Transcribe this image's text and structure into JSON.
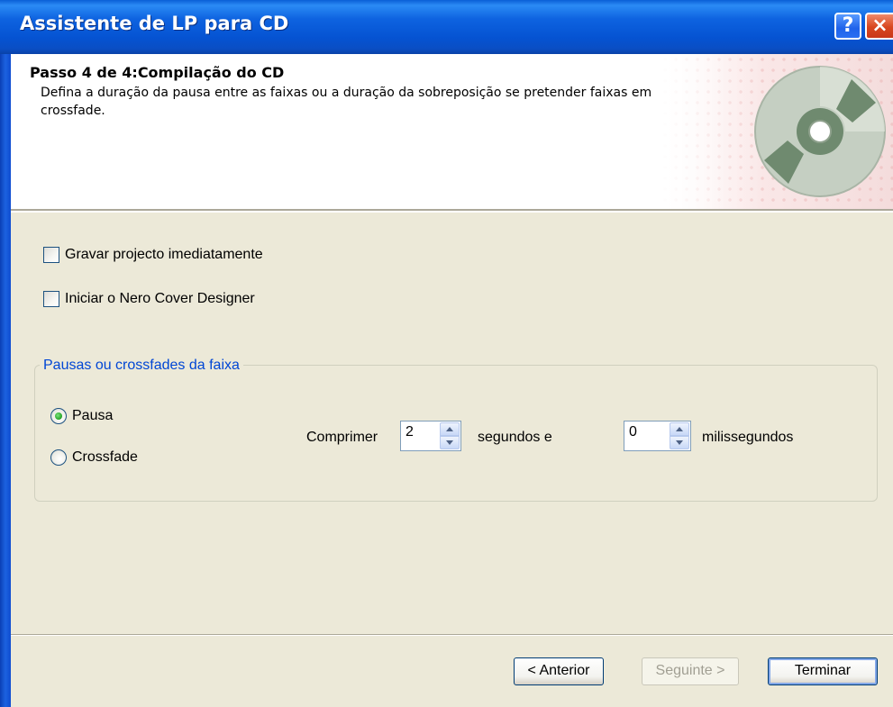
{
  "window": {
    "title": "Assistente de LP para CD",
    "help_label": "?",
    "close_label": "×"
  },
  "header": {
    "step_title": "Passo 4 de 4:Compilação do CD",
    "description": "Defina a duração da pausa entre as faixas ou a duração da sobreposição se pretender faixas em crossfade.",
    "icon": "cd-disc-icon"
  },
  "options": {
    "burn_now": {
      "label": "Gravar projecto imediatamente",
      "checked": false
    },
    "cover_designer": {
      "label": "Iniciar o Nero Cover Designer",
      "checked": false
    }
  },
  "track_gaps": {
    "legend": "Pausas ou crossfades da faixa",
    "pause_label": "Pausa",
    "pause_selected": true,
    "crossfade_label": "Crossfade",
    "crossfade_selected": false,
    "length_label": "Comprimer",
    "seconds_value": "2",
    "seconds_label": "segundos e",
    "ms_value": "0",
    "ms_label": "milissegundos"
  },
  "footer": {
    "back_label": "< Anterior",
    "next_label": "Seguinte >",
    "next_enabled": false,
    "finish_label": "Terminar"
  },
  "colors": {
    "titlebar": "#0553d2",
    "dialog_bg": "#ece9d8",
    "groupbox_legend": "#0046d5",
    "radio_dot": "#21a121"
  }
}
